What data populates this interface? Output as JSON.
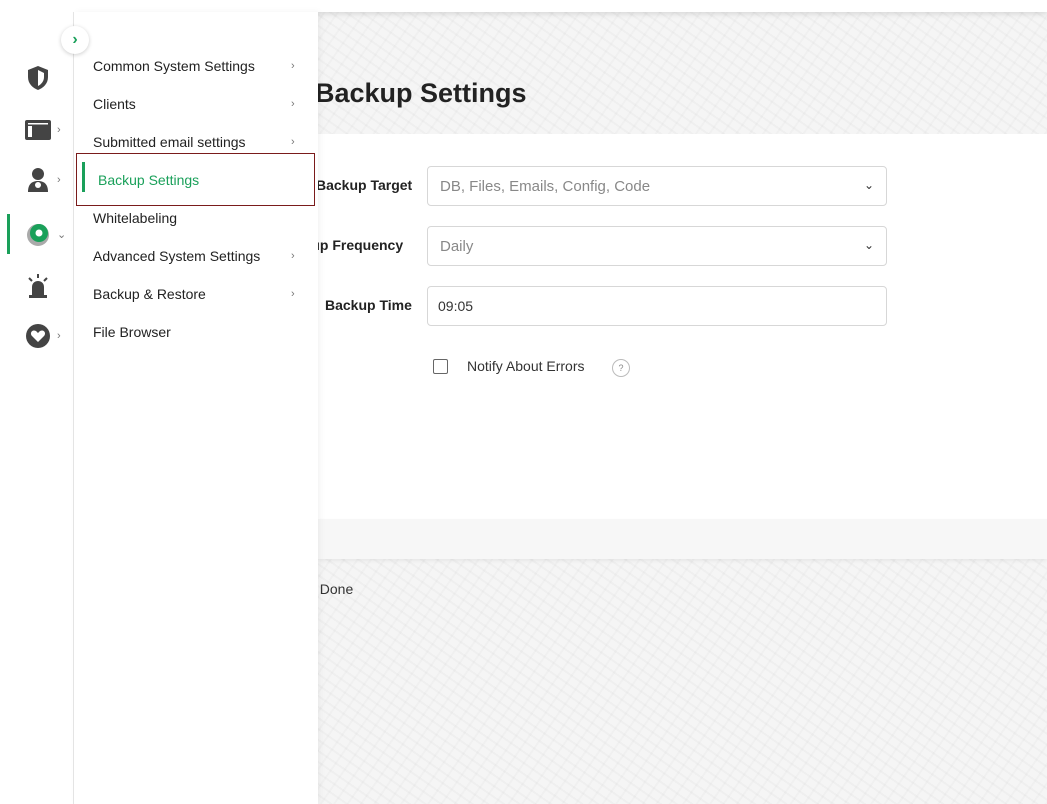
{
  "sidebar": {
    "toggle_icon": "chevron-right-icon",
    "rail": [
      {
        "icon": "shield-icon",
        "has_arrow": false
      },
      {
        "icon": "dashboard-icon",
        "has_arrow": true,
        "arrow": "›"
      },
      {
        "icon": "user-icon",
        "has_arrow": true,
        "arrow": "›"
      },
      {
        "icon": "gear-icon",
        "has_arrow": true,
        "arrow": "⌄",
        "active": true
      },
      {
        "icon": "alarm-icon",
        "has_arrow": false
      },
      {
        "icon": "heart-chat-icon",
        "has_arrow": true,
        "arrow": "›"
      }
    ],
    "submenu": [
      {
        "label": "Common System Settings",
        "arrow": "›"
      },
      {
        "label": "Clients",
        "arrow": "›"
      },
      {
        "label": "Submitted email settings",
        "arrow": "›"
      },
      {
        "label": "Backup Settings",
        "arrow": ""
      },
      {
        "label": "Whitelabeling",
        "arrow": ""
      },
      {
        "label": "Advanced System Settings",
        "arrow": "›"
      },
      {
        "label": "Backup & Restore",
        "arrow": "›"
      },
      {
        "label": "File Browser",
        "arrow": ""
      }
    ]
  },
  "main": {
    "title": "Backup Settings",
    "form": {
      "target_label": "Backup Target",
      "target_value": "DB, Files, Emails, Config, Code",
      "frequency_label": "ıp Frequency",
      "frequency_value": "Daily",
      "time_label": "Backup Time",
      "time_value": "09:05",
      "notify_label": "Notify About Errors",
      "help_glyph": "?",
      "caret": "⌄"
    },
    "done_text": ": Done"
  },
  "colors": {
    "accent": "#1aa05a",
    "selected_border": "#7a1b1b"
  }
}
